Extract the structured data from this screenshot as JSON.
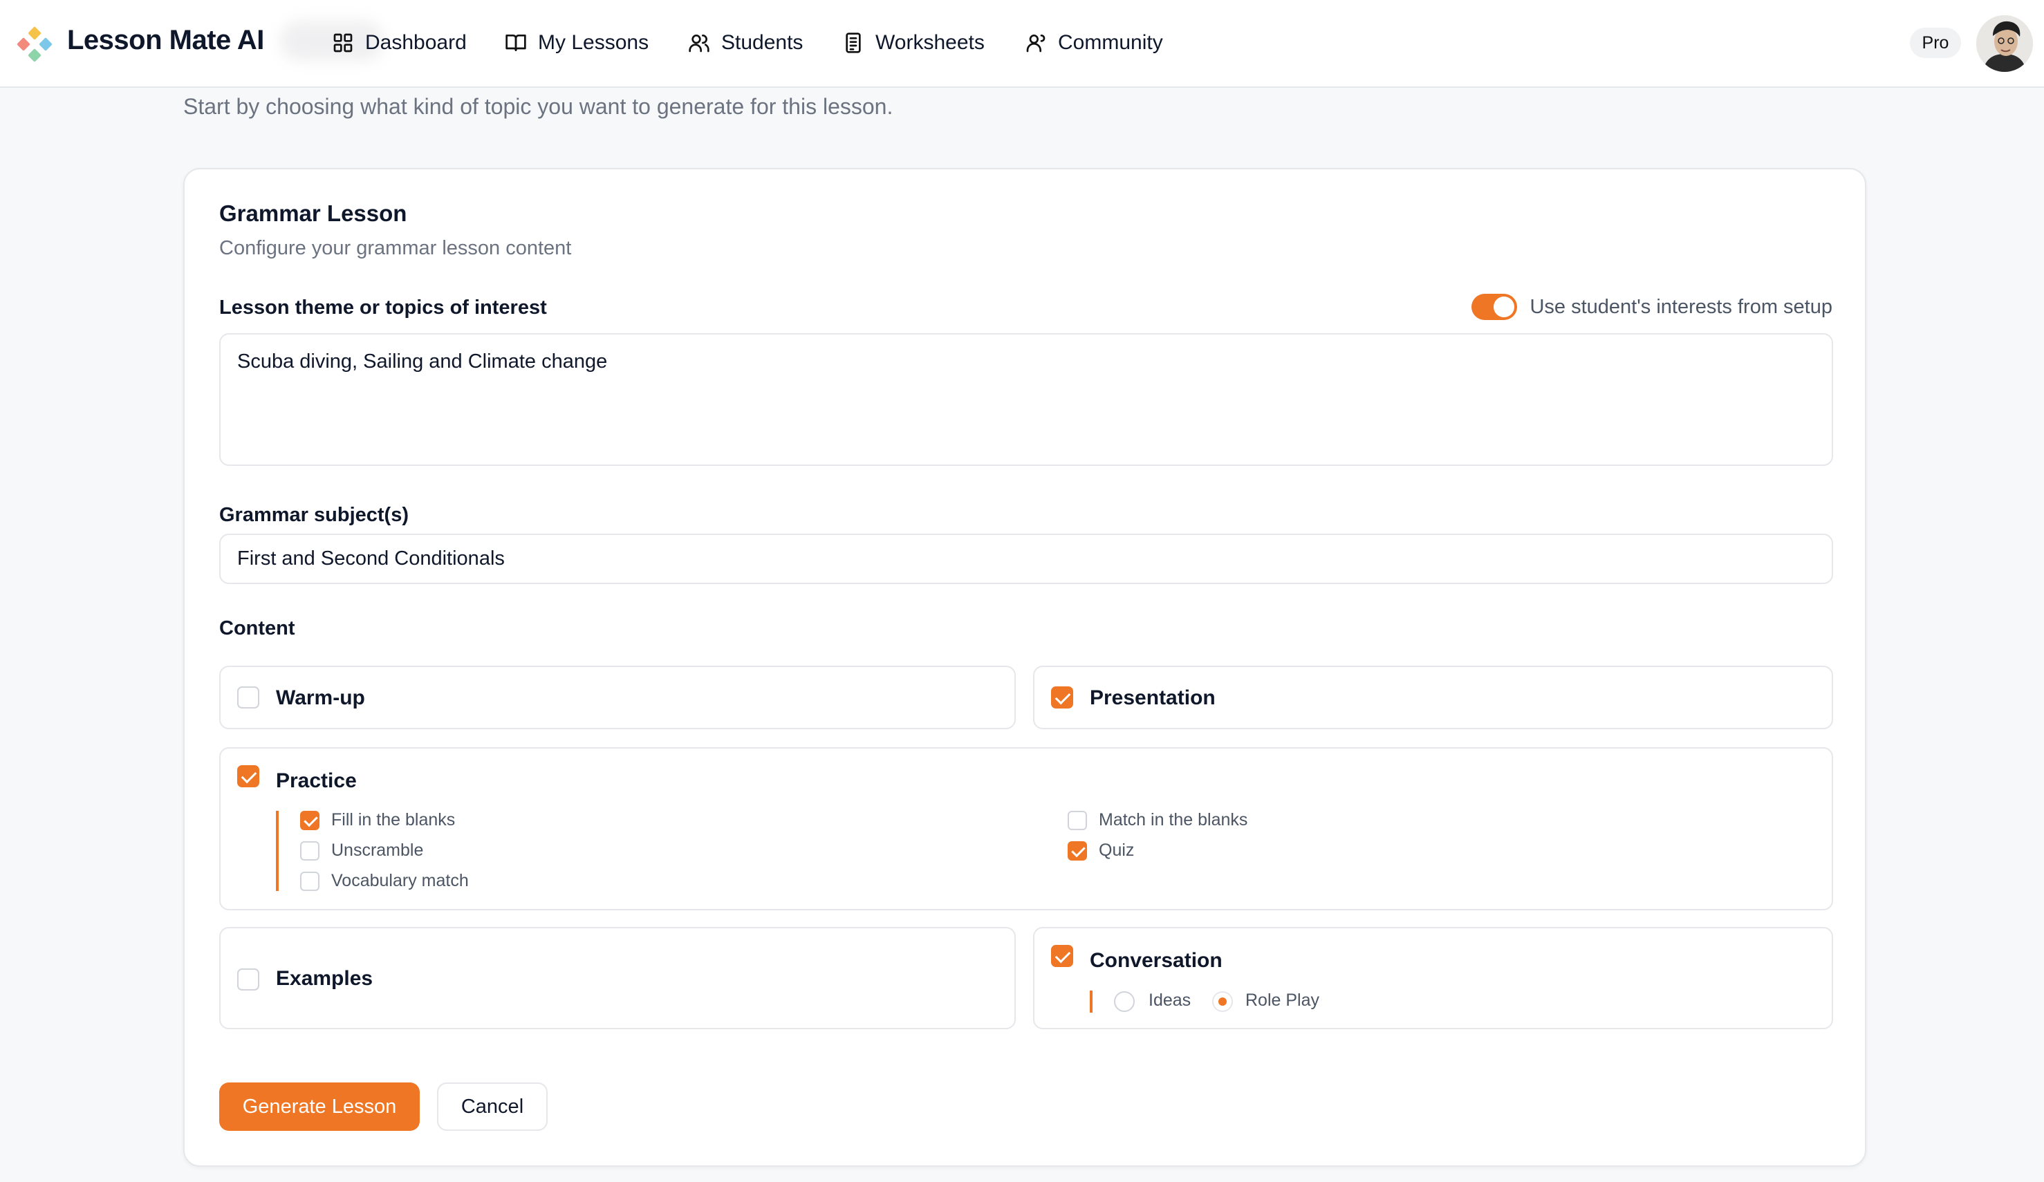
{
  "app": {
    "name": "Lesson Mate AI",
    "plan_badge": "Pro",
    "accent_color": "#ee7624"
  },
  "nav": {
    "items": [
      {
        "label": "Dashboard",
        "icon": "grid-icon"
      },
      {
        "label": "My Lessons",
        "icon": "book-icon"
      },
      {
        "label": "Students",
        "icon": "users-icon"
      },
      {
        "label": "Worksheets",
        "icon": "document-list-icon"
      },
      {
        "label": "Community",
        "icon": "community-icon"
      }
    ]
  },
  "intro_text": "Start by choosing what kind of topic you want to generate for this lesson.",
  "form": {
    "title": "Grammar Lesson",
    "description": "Configure your grammar lesson content",
    "theme_label": "Lesson theme or topics of interest",
    "interests_toggle_label": "Use student's interests from setup",
    "interests_toggle_on": true,
    "theme_value": "Scuba diving, Sailing and Climate change",
    "grammar_label": "Grammar subject(s)",
    "grammar_value": "First and Second Conditionals",
    "content_label": "Content",
    "sections": {
      "warmup": {
        "label": "Warm-up",
        "checked": false
      },
      "presentation": {
        "label": "Presentation",
        "checked": true
      },
      "practice": {
        "label": "Practice",
        "checked": true,
        "options": [
          {
            "label": "Fill in the blanks",
            "checked": true
          },
          {
            "label": "Unscramble",
            "checked": false
          },
          {
            "label": "Vocabulary match",
            "checked": false
          },
          {
            "label": "Match in the blanks",
            "checked": false
          },
          {
            "label": "Quiz",
            "checked": true
          }
        ]
      },
      "examples": {
        "label": "Examples",
        "checked": false
      },
      "conversation": {
        "label": "Conversation",
        "checked": true,
        "options": [
          {
            "label": "Ideas",
            "selected": false
          },
          {
            "label": "Role Play",
            "selected": true
          }
        ]
      }
    },
    "generate_button": "Generate Lesson",
    "cancel_button": "Cancel"
  }
}
